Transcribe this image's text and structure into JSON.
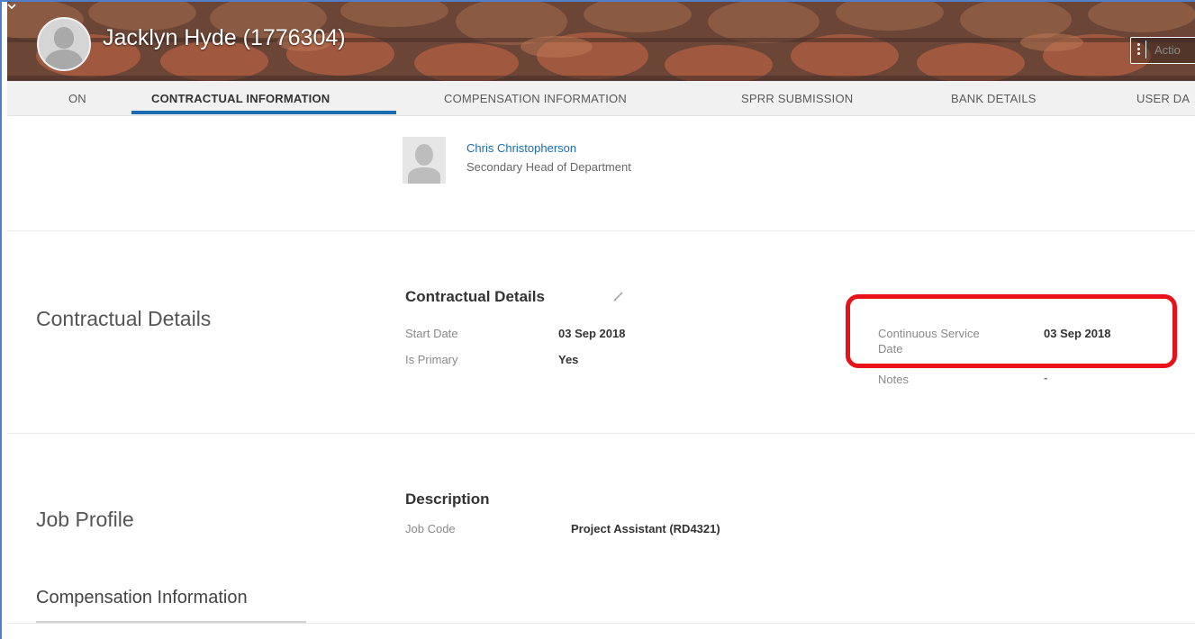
{
  "header": {
    "employee_name": "Jacklyn Hyde (1776304)",
    "actions_label": "Actio"
  },
  "tabs": [
    {
      "label": "ON",
      "active": false
    },
    {
      "label": "CONTRACTUAL INFORMATION",
      "active": true
    },
    {
      "label": "COMPENSATION INFORMATION",
      "active": false
    },
    {
      "label": "SPRR SUBMISSION",
      "active": false
    },
    {
      "label": "BANK DETAILS",
      "active": false
    },
    {
      "label": "USER DA",
      "active": false
    }
  ],
  "manager": {
    "name": "Chris Christopherson",
    "role": "Secondary Head of Department"
  },
  "contractual": {
    "section_title": "Contractual Details",
    "subhead": "Contractual Details",
    "start_date_label": "Start Date",
    "start_date_value": "03 Sep 2018",
    "is_primary_label": "Is Primary",
    "is_primary_value": "Yes",
    "continuous_service_label_line1": "Continuous Service",
    "continuous_service_label_line2": "Date",
    "continuous_service_value": "03 Sep 2018",
    "notes_label": "Notes",
    "notes_value": "-"
  },
  "job_profile": {
    "section_title": "Job Profile",
    "subhead": "Description",
    "job_code_label": "Job Code",
    "job_code_value": "Project Assistant (RD4321)"
  },
  "compensation": {
    "section_title": "Compensation Information"
  },
  "colors": {
    "link_blue": "#1a6bb0",
    "highlight_red": "#e8131a",
    "tab_bar": "#f1f1f1"
  }
}
